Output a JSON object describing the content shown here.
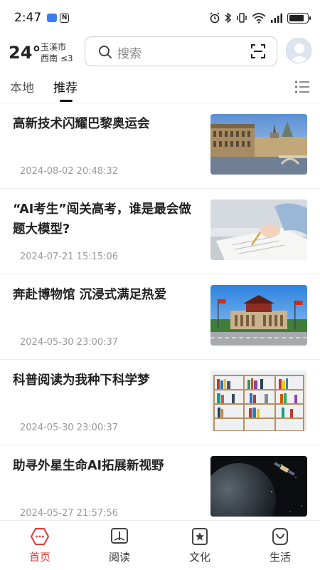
{
  "status_bar": {
    "time": "2:47",
    "battery_level": 0.9
  },
  "header": {
    "weather": {
      "temperature": "24°",
      "city": "玉溪市",
      "wind": "西南 ≤3"
    },
    "search": {
      "placeholder": "搜索"
    },
    "icons": [
      "search-icon",
      "scan-icon",
      "avatar"
    ]
  },
  "tabs": {
    "items": [
      {
        "label": "本地",
        "active": false
      },
      {
        "label": "推荐",
        "active": true
      }
    ]
  },
  "news": [
    {
      "title": "高新技术闪耀巴黎奥运会",
      "date": "2024-08-02 20:48:32",
      "image": "paris-building"
    },
    {
      "title": "“AI考生”闯关高考，谁是最会做题大模型?",
      "date": "2024-07-21 15:15:06",
      "image": "student-writing"
    },
    {
      "title": "奔赴博物馆 沉浸式满足热爱",
      "date": "2024-05-30 23:00:37",
      "image": "museum-building"
    },
    {
      "title": "科普阅读为我种下科学梦",
      "date": "2024-05-30 23:00:37",
      "image": "bookshelf"
    },
    {
      "title": "助寻外星生命AI拓展新视野",
      "date": "2024-05-27 21:57:56",
      "image": "planet-space"
    }
  ],
  "bottom_nav": {
    "items": [
      {
        "label": "首页",
        "icon": "home-hexagon-icon",
        "active": true
      },
      {
        "label": "阅读",
        "icon": "book-icon",
        "active": false
      },
      {
        "label": "文化",
        "icon": "star-badge-icon",
        "active": false
      },
      {
        "label": "生活",
        "icon": "smile-icon",
        "active": false
      }
    ]
  },
  "colors": {
    "accent": "#e53935",
    "text": "#222222",
    "date": "#999999"
  }
}
